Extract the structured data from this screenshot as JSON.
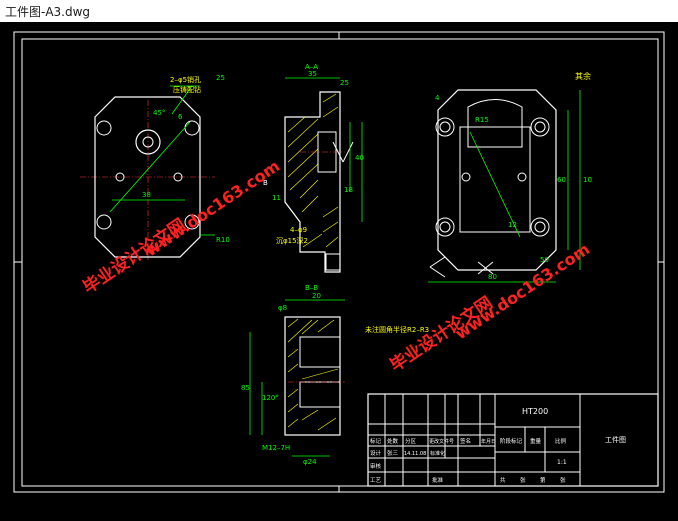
{
  "window": {
    "title": "工件图-A3.dwg"
  },
  "colors": {
    "background": "#000000",
    "line": "#ffffff",
    "dim": "#00ff00",
    "text": "#ffff00",
    "hatch": "#ffff00",
    "axis": "#ff3030",
    "watermark": "#ff2020"
  },
  "drawing": {
    "section_aa": "A–A",
    "section_bb": "B–B",
    "rest_note": "其余",
    "note_holes1": "2–φ5销孔",
    "note_holes1_sub": "压铸配钻",
    "note_holes2": "4–φ9",
    "note_holes2_sub": "沉φ15深2",
    "fillet_note": "未注圆角半径R2–R3",
    "dims": {
      "d35": "35",
      "d20": "20",
      "d25a": "25",
      "d25b": "25",
      "d38": "38",
      "d10": "10",
      "d80": "80",
      "d85": "85",
      "d24": "φ24",
      "d8": "φ8",
      "angle45": "45°",
      "angle120": "120°",
      "r10": "R10",
      "thread": "M12–7H",
      "r15": "R15",
      "d4": "4",
      "d6": "6",
      "d18": "18",
      "d11": "11",
      "d40": "40",
      "d60": "60",
      "d12": "12",
      "d50": "50"
    },
    "labels": {
      "a_left": "A",
      "b_left": "B"
    }
  },
  "title_block": {
    "material": "HT200",
    "part_name": "工件图",
    "row1": [
      "标记",
      "处数",
      "分区",
      "更改文件号",
      "签名",
      "年月日"
    ],
    "row2": [
      "设计",
      "张三",
      "14.11.08",
      "标准化"
    ],
    "row3_label": "审核",
    "row4_label": "工艺",
    "row4_approve": "批准",
    "stage_header": [
      "阶段标记",
      "重量",
      "比例"
    ],
    "scale": "1:1",
    "sheet": [
      "共",
      "张",
      "第",
      "张"
    ]
  },
  "watermarks": {
    "cn": "毕业设计论文网",
    "url": "www.doc163.com"
  }
}
